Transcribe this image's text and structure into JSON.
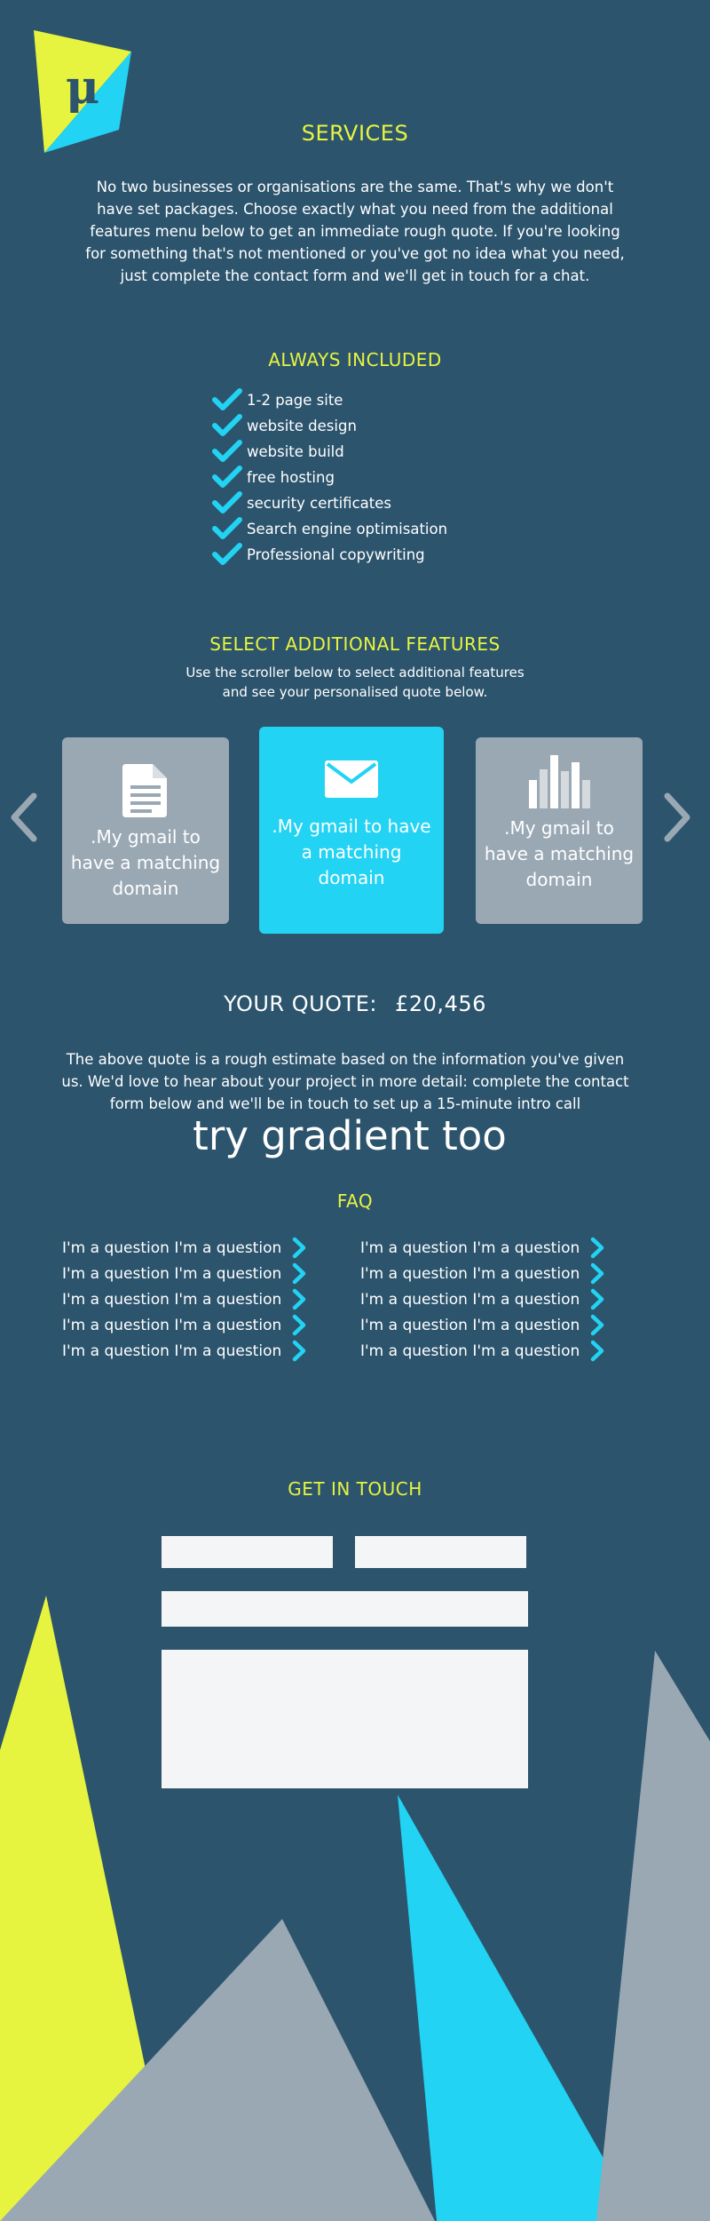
{
  "services": {
    "title": "SERVICES",
    "intro": "No two businesses or organisations are the same. That's why we don't have set packages. Choose exactly what you need from the additional features menu below to get an immediate rough quote. If you're looking for something that's not mentioned or you've got no idea what you need, just complete the contact form and we'll get in touch for a chat."
  },
  "always_included": {
    "title": "ALWAYS INCLUDED",
    "items": [
      "1-2 page site",
      "website design",
      "website build",
      "free hosting",
      "security certificates",
      "Search engine optimisation",
      "Professional copywriting"
    ]
  },
  "features": {
    "title": "SELECT ADDITIONAL FEATURES",
    "subtitle": "Use the scroller below to select additional features and see your personalised quote below.",
    "cards": [
      {
        "icon": "document-icon",
        "label": ".My gmail to have a matching domain",
        "selected": false
      },
      {
        "icon": "envelope-icon",
        "label": ".My gmail to have a matching domain",
        "selected": true
      },
      {
        "icon": "bar-chart-icon",
        "label": ".My gmail to have a matching domain",
        "selected": false
      }
    ]
  },
  "quote": {
    "label": "YOUR QUOTE:",
    "amount": "£20,456",
    "description": "The above quote is a rough estimate based on the information you've given us. We'd love to hear about your project in more detail: complete the contact form below and we'll be in touch to set up a 15-minute intro call"
  },
  "gradient_text": "try gradient too",
  "faq": {
    "title": "FAQ",
    "left": [
      "I'm a question I'm a question",
      "I'm a question I'm a question",
      "I'm a question I'm a question",
      "I'm a question I'm a question",
      "I'm a question I'm a question"
    ],
    "right": [
      "I'm a question I'm a question",
      "I'm a question I'm a question",
      "I'm a question I'm a question",
      "I'm a question I'm a question",
      "I'm a question I'm a question"
    ]
  },
  "contact": {
    "title": "GET IN TOUCH"
  },
  "colors": {
    "background": "#2c546d",
    "accent_yellow": "#e7f43f",
    "accent_cyan": "#22d3f3",
    "gray": "#9aa8b4",
    "field": "#f4f5f7"
  }
}
